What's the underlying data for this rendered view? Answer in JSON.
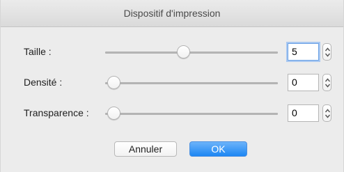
{
  "dialog": {
    "title": "Dispositif d'impression"
  },
  "settings": [
    {
      "label": "Taille :",
      "value": "5",
      "slider_fraction": 0.45,
      "focused": true
    },
    {
      "label": "Densité :",
      "value": "0",
      "slider_fraction": 0.0,
      "focused": false
    },
    {
      "label": "Transparence :",
      "value": "0",
      "slider_fraction": 0.0,
      "focused": false
    }
  ],
  "buttons": {
    "cancel_label": "Annuler",
    "ok_label": "OK"
  },
  "colors": {
    "accent": "#1c86f3",
    "focus_ring": "#a9c8f1"
  }
}
